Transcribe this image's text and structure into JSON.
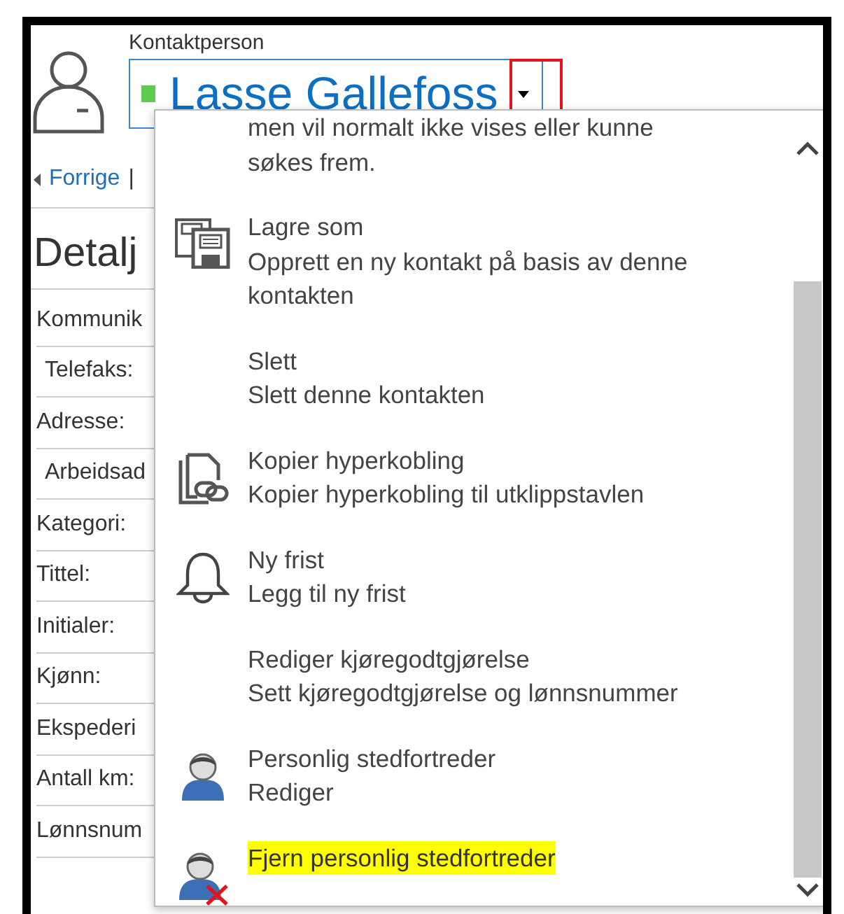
{
  "contact": {
    "label": "Kontaktperson",
    "name": "Lasse Gallefoss"
  },
  "nav": {
    "previous": "Forrige",
    "separator": "|"
  },
  "section": {
    "title": "Detalj"
  },
  "fields": [
    {
      "label": "Kommunik",
      "children": [
        {
          "label": "Telefaks:"
        }
      ]
    },
    {
      "label": "Adresse:",
      "children": [
        {
          "label": "Arbeidsad"
        }
      ]
    },
    {
      "label": "Kategori:"
    },
    {
      "label": "Tittel:"
    },
    {
      "label": "Initialer:"
    },
    {
      "label": "Kjønn:"
    },
    {
      "label": "Ekspederi"
    },
    {
      "label": "Antall km:"
    },
    {
      "label": "Lønnsnum"
    }
  ],
  "menu": {
    "intro": "men vil normalt ikke vises eller kunne søkes frem.",
    "items": [
      {
        "kind": "save-as",
        "title": "Lagre som",
        "description": "Opprett en ny kontakt på basis av denne kontakten",
        "highlighted": false
      },
      {
        "kind": "none",
        "title": "Slett",
        "description": "Slett denne kontakten",
        "highlighted": false
      },
      {
        "kind": "copy-link",
        "title": "Kopier hyperkobling",
        "description": "Kopier hyperkobling til utklippstavlen",
        "highlighted": false
      },
      {
        "kind": "bell",
        "title": "Ny frist",
        "description": "Legg til ny frist",
        "highlighted": false
      },
      {
        "kind": "none",
        "title": "Rediger kjøregodtgjørelse",
        "description": "Sett kjøregodtgjørelse og lønnsnummer",
        "highlighted": false
      },
      {
        "kind": "person",
        "title": "Personlig stedfortreder",
        "description": "Rediger",
        "highlighted": false
      },
      {
        "kind": "person-remove",
        "title": "Fjern personlig stedfortreder",
        "highlighted": true
      }
    ]
  }
}
